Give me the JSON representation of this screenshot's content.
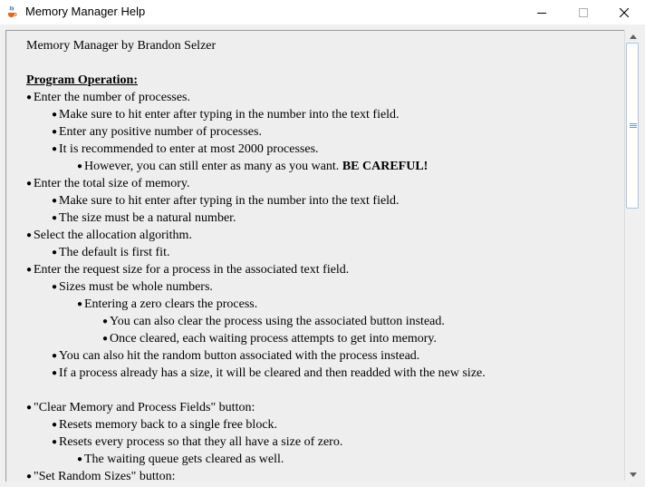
{
  "window": {
    "title": "Memory Manager Help",
    "icon": "java-cup-icon",
    "controls": [
      "minimize",
      "maximize",
      "close"
    ]
  },
  "help": {
    "header": "Memory Manager by Brandon Selzer",
    "section_title": "Program Operation:",
    "lines": [
      {
        "level": 0,
        "text": "Enter the number of processes."
      },
      {
        "level": 1,
        "text": "Make sure to hit enter after typing in the number into the text field."
      },
      {
        "level": 1,
        "text": "Enter any positive number of processes."
      },
      {
        "level": 1,
        "text": "It is recommended to enter at most 2000 processes."
      },
      {
        "level": 2,
        "text": "However, you can still enter as many as you want. ",
        "bold": "BE CAREFUL!"
      },
      {
        "level": 0,
        "text": "Enter the total size of memory."
      },
      {
        "level": 1,
        "text": "Make sure to hit enter after typing in the number into the text field."
      },
      {
        "level": 1,
        "text": "The size must be a natural number."
      },
      {
        "level": 0,
        "text": "Select the allocation algorithm."
      },
      {
        "level": 1,
        "text": "The default is first fit."
      },
      {
        "level": 0,
        "text": "Enter the request size for a process in the associated text field."
      },
      {
        "level": 1,
        "text": "Sizes must be whole numbers."
      },
      {
        "level": 2,
        "text": "Entering a zero clears the process."
      },
      {
        "level": 3,
        "text": "You can also clear the process using the associated button instead."
      },
      {
        "level": 3,
        "text": "Once cleared, each waiting process attempts to get into memory."
      },
      {
        "level": 1,
        "text": "You can also hit the random button associated with the process instead."
      },
      {
        "level": 1,
        "text": "If a process already has a size, it will be cleared and then readded with the new size."
      },
      {
        "level": -1,
        "text": ""
      },
      {
        "level": 0,
        "text": "\"Clear Memory and Process Fields\" button:"
      },
      {
        "level": 1,
        "text": "Resets memory back to a single free block."
      },
      {
        "level": 1,
        "text": "Resets every process so that they all have a size of zero."
      },
      {
        "level": 2,
        "text": "The waiting queue gets cleared as well."
      },
      {
        "level": 0,
        "text": "\"Set Random Sizes\" button:"
      }
    ]
  },
  "scrollbar": {
    "up_icon": "scroll-up-arrow-icon",
    "down_icon": "scroll-down-arrow-icon",
    "visible_fraction": 0.37,
    "position_fraction": 0.0
  }
}
